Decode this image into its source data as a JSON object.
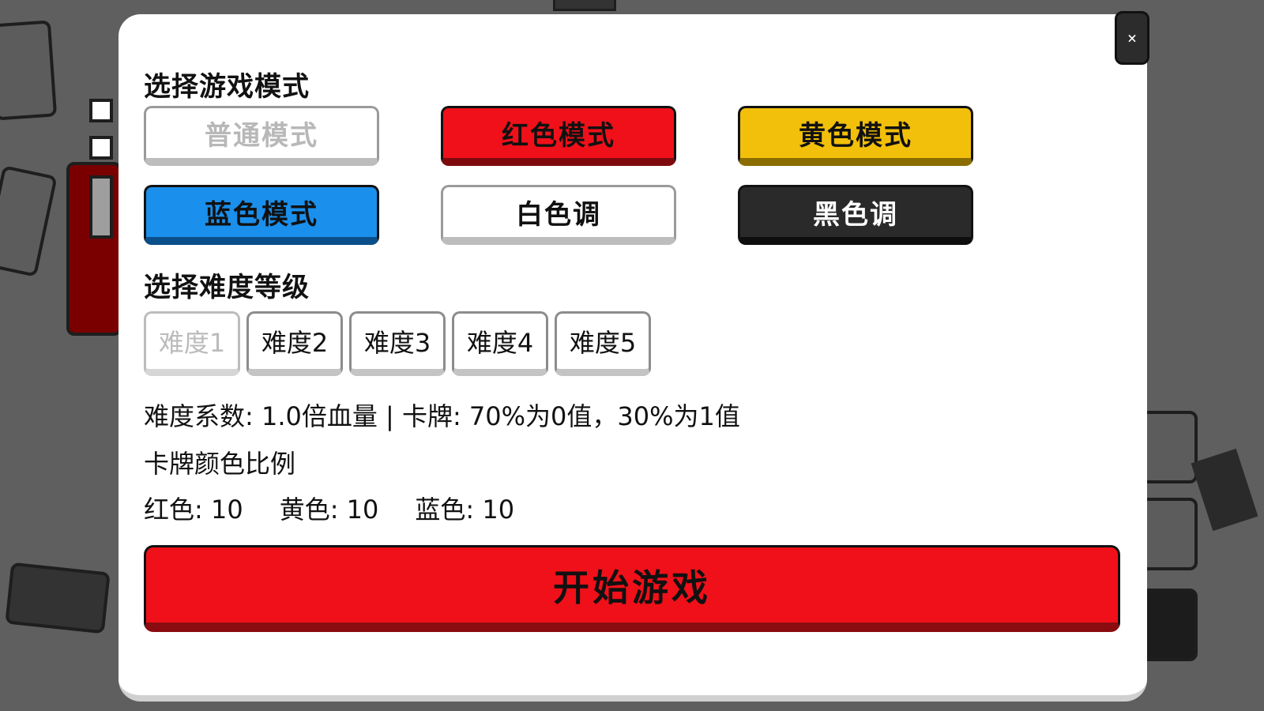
{
  "modal": {
    "close_label": "×"
  },
  "mode_section": {
    "label": "选择游戏模式",
    "modes": [
      {
        "label": "普通模式",
        "bg": "#ffffff",
        "text": "#b8b8b8",
        "state": "selected"
      },
      {
        "label": "红色模式",
        "bg": "#f01019",
        "text": "#111111"
      },
      {
        "label": "黄色模式",
        "bg": "#f2c00a",
        "text": "#111111"
      },
      {
        "label": "蓝色模式",
        "bg": "#1a8fec",
        "text": "#111111"
      },
      {
        "label": "白色调",
        "bg": "#ffffff",
        "text": "#111111"
      },
      {
        "label": "黑色调",
        "bg": "#2a2a2a",
        "text": "#ffffff"
      }
    ]
  },
  "difficulty_section": {
    "label": "选择难度等级",
    "levels": [
      {
        "label": "难度1",
        "state": "selected"
      },
      {
        "label": "难度2"
      },
      {
        "label": "难度3"
      },
      {
        "label": "难度4"
      },
      {
        "label": "难度5"
      }
    ]
  },
  "info": {
    "difficulty_text": "难度系数: 1.0倍血量 | 卡牌: 70%为0值，30%为1值",
    "ratio_label": "卡牌颜色比例",
    "ratios": [
      {
        "label": "红色: 10"
      },
      {
        "label": "黄色: 10"
      },
      {
        "label": "蓝色: 10"
      }
    ]
  },
  "start_button": {
    "label": "开始游戏"
  },
  "colors": {
    "accent_red": "#f01019",
    "accent_yellow": "#f2c00a",
    "accent_blue": "#1a8fec",
    "dark": "#2a2a2a"
  }
}
